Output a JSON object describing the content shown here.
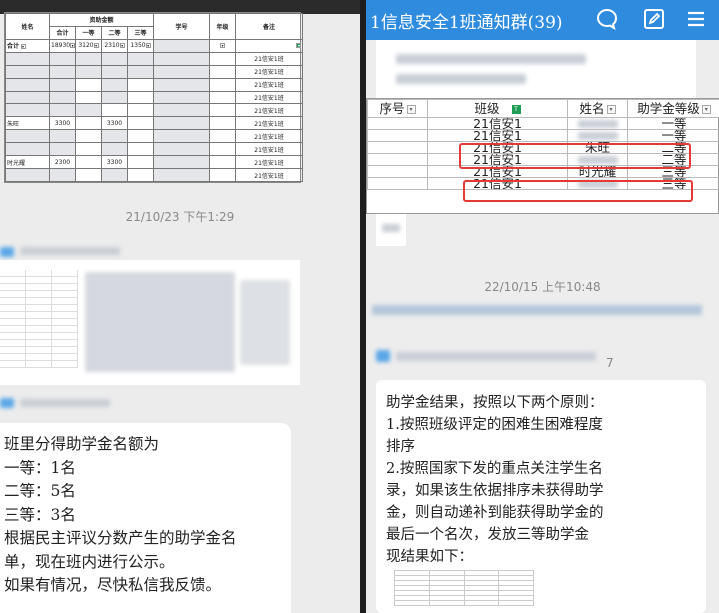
{
  "left": {
    "sheet": {
      "header_top": [
        "姓名",
        "资助金额",
        "学号",
        "年级",
        "备注"
      ],
      "header_sub": [
        "合计",
        "一等",
        "二等",
        "三等"
      ],
      "total_row": [
        "合计",
        "18930",
        "3120",
        "2310",
        "1350"
      ],
      "class_label": "21信安1班",
      "rows": [
        {
          "name": "",
          "v1": "",
          "v2": "",
          "v3": ""
        },
        {
          "name": "",
          "v1": "",
          "v2": "",
          "v3": ""
        },
        {
          "name": "",
          "v1": "",
          "v2": "",
          "v3": ""
        },
        {
          "name": "",
          "v1": "",
          "v2": "",
          "v3": ""
        },
        {
          "name": "",
          "v1": "",
          "v2": "",
          "v3": ""
        },
        {
          "name": "朱旺",
          "v1": "3300",
          "v2": "3300",
          "v3": ""
        },
        {
          "name": "",
          "v1": "",
          "v2": "",
          "v3": ""
        },
        {
          "name": "",
          "v1": "",
          "v2": "",
          "v3": ""
        },
        {
          "name": "时光耀",
          "v1": "2300",
          "v2": "3300",
          "v3": ""
        },
        {
          "name": "",
          "v1": "",
          "v2": "",
          "v3": ""
        }
      ]
    },
    "timestamp": "21/10/23 下午1:29",
    "message_lines": [
      "班里分得助学金名额为",
      "一等：1名",
      "二等：5名",
      "三等：3名",
      "根据民主评议分数产生的助学金名",
      "单，现在班内进行公示。",
      "如果有情况，尽快私信我反馈。"
    ]
  },
  "right": {
    "title": "1信息安全1班通知群(39)",
    "icons": [
      "chat-bubble-icon",
      "edit-icon",
      "menu-icon"
    ],
    "sheet": {
      "headers": [
        "序号",
        "班级",
        "姓名",
        "助学金等级"
      ],
      "rows": [
        {
          "cls": "21信安1",
          "name": "",
          "level": "一等"
        },
        {
          "cls": "21信安1",
          "name": "",
          "level": "一等"
        },
        {
          "cls": "21信安1",
          "name": "朱旺",
          "level": "二等"
        },
        {
          "cls": "21信安1",
          "name": "",
          "level": "二等"
        },
        {
          "cls": "21信安1",
          "name": "时光耀",
          "level": "三等"
        },
        {
          "cls": "21信安1",
          "name": "",
          "level": "三等"
        }
      ]
    },
    "timestamp": "22/10/15 上午10:48",
    "sender_suffix": "7",
    "message_lines": [
      "助学金结果，按照以下两个原则：",
      "1.按照班级评定的困难生困难程度",
      "排序",
      "2.按照国家下发的重点关注学生名",
      "录，如果该生依据排序未获得助学",
      "金，则自动递补到能获得助学金的",
      "最后一个名次，发放三等助学金",
      "现结果如下："
    ]
  }
}
